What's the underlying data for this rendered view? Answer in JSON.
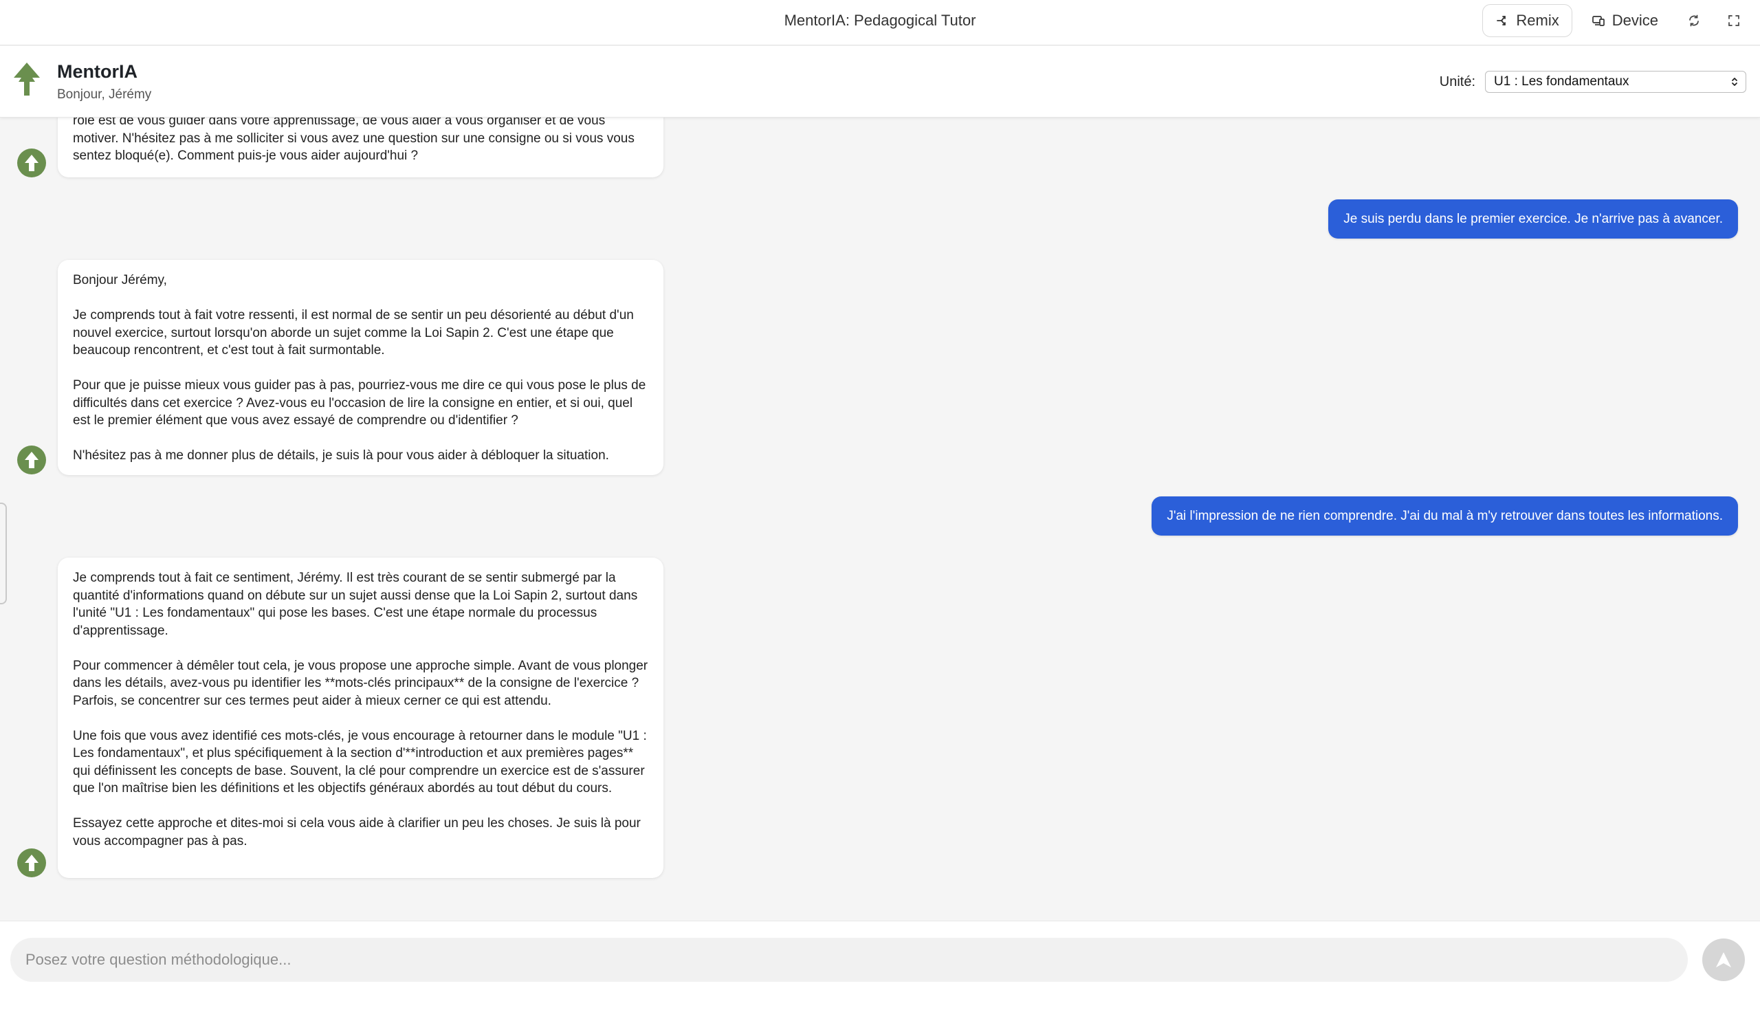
{
  "window": {
    "title": "MentorIA: Pedagogical Tutor",
    "remix_label": "Remix",
    "device_label": "Device"
  },
  "header": {
    "app_name": "MentorIA",
    "greeting": "Bonjour, Jérémy",
    "unit_label": "Unité:",
    "unit_selected": "U1 : Les fondamentaux"
  },
  "messages": {
    "m1": {
      "role": "bot",
      "paragraphs": [
        "rôle est de vous guider dans votre apprentissage, de vous aider à vous organiser et de vous motiver. N'hésitez pas à me solliciter si vous avez une question sur une consigne ou si vous vous sentez bloqué(e). Comment puis-je vous aider aujourd'hui ?"
      ]
    },
    "m2": {
      "role": "user",
      "text": "Je suis perdu dans le premier exercice. Je n'arrive pas à avancer."
    },
    "m3": {
      "role": "bot",
      "paragraphs": [
        "Bonjour Jérémy,",
        "Je comprends tout à fait votre ressenti, il est normal de se sentir un peu désorienté au début d'un nouvel exercice, surtout lorsqu'on aborde un sujet comme la Loi Sapin 2. C'est une étape que beaucoup rencontrent, et c'est tout à fait surmontable.",
        "Pour que je puisse mieux vous guider pas à pas, pourriez-vous me dire ce qui vous pose le plus de difficultés dans cet exercice ? Avez-vous eu l'occasion de lire la consigne en entier, et si oui, quel est le premier élément que vous avez essayé de comprendre ou d'identifier ?",
        "N'hésitez pas à me donner plus de détails, je suis là pour vous aider à débloquer la situation."
      ]
    },
    "m4": {
      "role": "user",
      "text": "J'ai l'impression de ne rien comprendre. J'ai du mal à m'y retrouver dans toutes les informations."
    },
    "m5": {
      "role": "bot",
      "paragraphs": [
        "Je comprends tout à fait ce sentiment, Jérémy. Il est très courant de se sentir submergé par la quantité d'informations quand on débute sur un sujet aussi dense que la Loi Sapin 2, surtout dans l'unité \"U1 : Les fondamentaux\" qui pose les bases. C'est une étape normale du processus d'apprentissage.",
        "Pour commencer à démêler tout cela, je vous propose une approche simple. Avant de vous plonger dans les détails, avez-vous pu identifier les **mots-clés principaux** de la consigne de l'exercice ? Parfois, se concentrer sur ces termes peut aider à mieux cerner ce qui est attendu.",
        "Une fois que vous avez identifié ces mots-clés, je vous encourage à retourner dans le module \"U1 : Les fondamentaux\", et plus spécifiquement à la section d'**introduction et aux premières pages** qui définissent les concepts de base. Souvent, la clé pour comprendre un exercice est de s'assurer que l'on maîtrise bien les définitions et les objectifs généraux abordés au tout début du cours.",
        "Essayez cette approche et dites-moi si cela vous aide à clarifier un peu les choses. Je suis là pour vous accompagner pas à pas."
      ]
    }
  },
  "composer": {
    "placeholder": "Posez votre question méthodologique..."
  },
  "colors": {
    "accent": "#2b5fd9",
    "brand_green": "#6a8f4e"
  },
  "icons": [
    "remix-icon",
    "device-icon",
    "refresh-icon",
    "fullscreen-icon",
    "tree-logo-icon",
    "send-icon"
  ]
}
